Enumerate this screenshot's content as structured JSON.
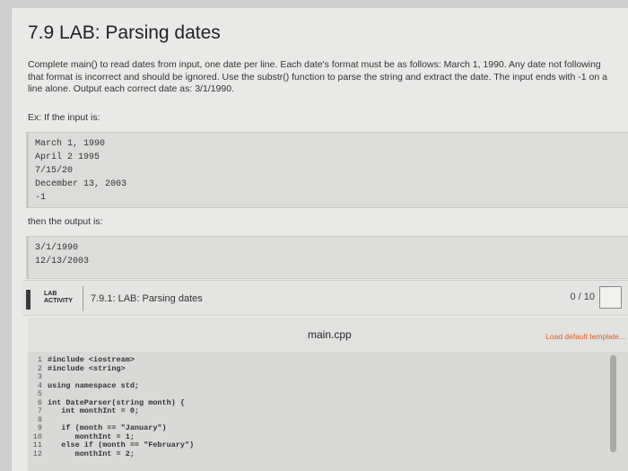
{
  "lab": {
    "title": "7.9 LAB: Parsing dates",
    "description_lines": [
      "Complete main() to read dates from input, one date per line. Each date's format must be as follows: March 1, 1990. Any date not following",
      "that format is incorrect and should be ignored. Use the substr() function to parse the string and extract the date. The input ends with -1 on a",
      "line alone. Output each correct date as: 3/1/1990."
    ],
    "example_label": "Ex: If the input is:",
    "input_lines": [
      "March 1, 1990",
      "April 2 1995",
      "7/15/20",
      "December 13, 2003",
      "-1"
    ],
    "then_label": "then the output is:",
    "output_lines": [
      "3/1/1990",
      "12/13/2003"
    ]
  },
  "activity": {
    "tag_line1": "LAB",
    "tag_line2": "ACTIVITY",
    "title": "7.9.1: LAB: Parsing dates",
    "score": "0 / 10"
  },
  "editor": {
    "filename": "main.cpp",
    "load_template": "Load default template...",
    "code": [
      {
        "n": "1",
        "text": "#include <iostream>"
      },
      {
        "n": "2",
        "text": "#include <string>"
      },
      {
        "n": "3",
        "text": ""
      },
      {
        "n": "4",
        "text": "using namespace std;"
      },
      {
        "n": "5",
        "text": ""
      },
      {
        "n": "6",
        "text": "int DateParser(string month) {"
      },
      {
        "n": "7",
        "text": "   int monthInt = 0;"
      },
      {
        "n": "8",
        "text": ""
      },
      {
        "n": "9",
        "text": "   if (month == \"January\")"
      },
      {
        "n": "10",
        "text": "      monthInt = 1;"
      },
      {
        "n": "11",
        "text": "   else if (month == \"February\")"
      },
      {
        "n": "12",
        "text": "      monthInt = 2;"
      }
    ]
  }
}
